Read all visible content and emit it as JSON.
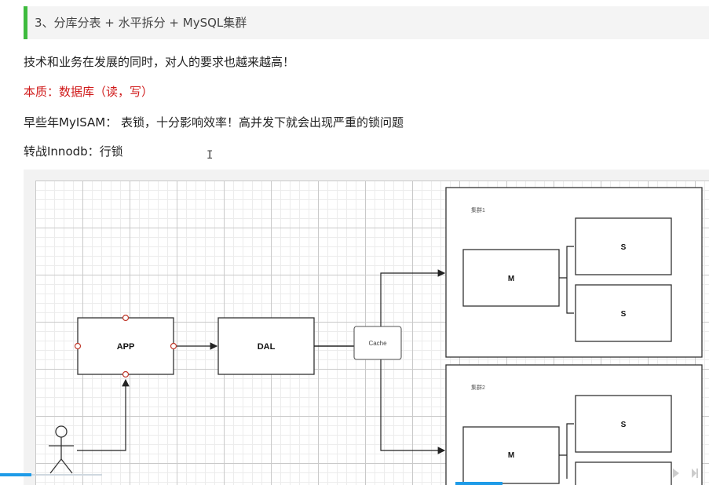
{
  "heading": {
    "text": "3、分库分表 + 水平拆分 + MySQL集群",
    "accent_color": "#3dbb3d"
  },
  "lines": [
    {
      "text": "技术和业务在发展的同时，对人的要求也越来越高！"
    },
    {
      "text": "本质：数据库（读，写）",
      "color": "#d01b1b"
    },
    {
      "text": "早些年MyISAM： 表锁，十分影响效率！高并发下就会出现严重的锁问题"
    },
    {
      "text": "转战Innodb：行锁"
    }
  ],
  "cursor_glyph": "I",
  "diagram": {
    "app_label": "APP",
    "dal_label": "DAL",
    "cache_label": "Cache",
    "cluster1_label": "集群1",
    "cluster2_label": "集群2",
    "master_label": "M",
    "slave_label": "S"
  },
  "player": {
    "progress_color": "#1e9be8"
  }
}
